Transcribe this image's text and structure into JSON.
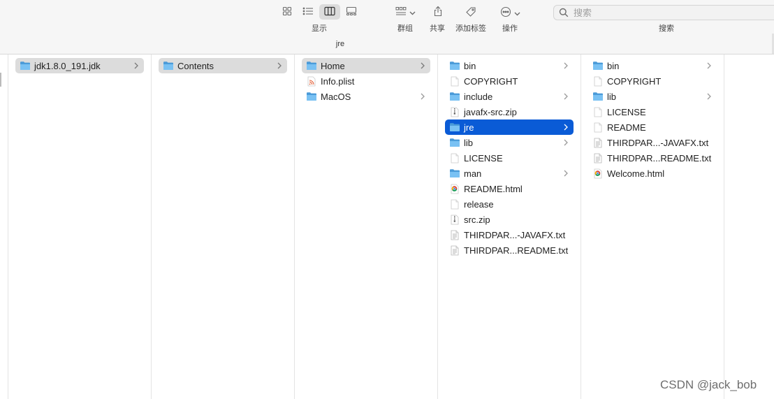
{
  "window": {
    "title": "jre"
  },
  "toolbar": {
    "view_label": "显示",
    "group_label": "群组",
    "share_label": "共享",
    "tags_label": "添加标签",
    "action_label": "操作",
    "search_label": "搜索",
    "search_placeholder": "搜索",
    "active_view": "column",
    "icons": [
      "icon-view-icon",
      "list-view-icon",
      "column-view-icon",
      "gallery-view-icon",
      "group-icon",
      "share-icon",
      "tag-icon",
      "action-icon",
      "search-icon"
    ]
  },
  "columns": [
    {
      "items": [
        {
          "name": "jdk1.8.0_191.jdk",
          "type": "folder",
          "has_children": true,
          "selected": "gray"
        }
      ]
    },
    {
      "items": [
        {
          "name": "Contents",
          "type": "folder",
          "has_children": true,
          "selected": "gray"
        }
      ]
    },
    {
      "items": [
        {
          "name": "Home",
          "type": "folder",
          "has_children": true,
          "selected": "gray"
        },
        {
          "name": "Info.plist",
          "type": "plist",
          "has_children": false,
          "selected": ""
        },
        {
          "name": "MacOS",
          "type": "folder",
          "has_children": true,
          "selected": ""
        }
      ]
    },
    {
      "items": [
        {
          "name": "bin",
          "type": "folder",
          "has_children": true,
          "selected": ""
        },
        {
          "name": "COPYRIGHT",
          "type": "doc",
          "has_children": false,
          "selected": ""
        },
        {
          "name": "include",
          "type": "folder",
          "has_children": true,
          "selected": ""
        },
        {
          "name": "javafx-src.zip",
          "type": "zip",
          "has_children": false,
          "selected": ""
        },
        {
          "name": "jre",
          "type": "folder",
          "has_children": true,
          "selected": "blue"
        },
        {
          "name": "lib",
          "type": "folder",
          "has_children": true,
          "selected": ""
        },
        {
          "name": "LICENSE",
          "type": "doc",
          "has_children": false,
          "selected": ""
        },
        {
          "name": "man",
          "type": "folder",
          "has_children": true,
          "selected": ""
        },
        {
          "name": "README.html",
          "type": "html",
          "has_children": false,
          "selected": ""
        },
        {
          "name": "release",
          "type": "doc",
          "has_children": false,
          "selected": ""
        },
        {
          "name": "src.zip",
          "type": "zip",
          "has_children": false,
          "selected": ""
        },
        {
          "name": "THIRDPAR...-JAVAFX.txt",
          "type": "txt",
          "has_children": false,
          "selected": ""
        },
        {
          "name": "THIRDPAR...README.txt",
          "type": "txt",
          "has_children": false,
          "selected": ""
        }
      ]
    },
    {
      "items": [
        {
          "name": "bin",
          "type": "folder",
          "has_children": true,
          "selected": ""
        },
        {
          "name": "COPYRIGHT",
          "type": "doc",
          "has_children": false,
          "selected": ""
        },
        {
          "name": "lib",
          "type": "folder",
          "has_children": true,
          "selected": ""
        },
        {
          "name": "LICENSE",
          "type": "doc",
          "has_children": false,
          "selected": ""
        },
        {
          "name": "README",
          "type": "doc",
          "has_children": false,
          "selected": ""
        },
        {
          "name": "THIRDPAR...-JAVAFX.txt",
          "type": "txt",
          "has_children": false,
          "selected": ""
        },
        {
          "name": "THIRDPAR...README.txt",
          "type": "txt",
          "has_children": false,
          "selected": ""
        },
        {
          "name": "Welcome.html",
          "type": "html",
          "has_children": false,
          "selected": ""
        }
      ]
    }
  ],
  "watermark": "CSDN @jack_bob",
  "colors": {
    "selection_blue": "#0a5bd6",
    "selection_gray": "#dcdcdc",
    "folder_blue": "#5bb0ee"
  }
}
